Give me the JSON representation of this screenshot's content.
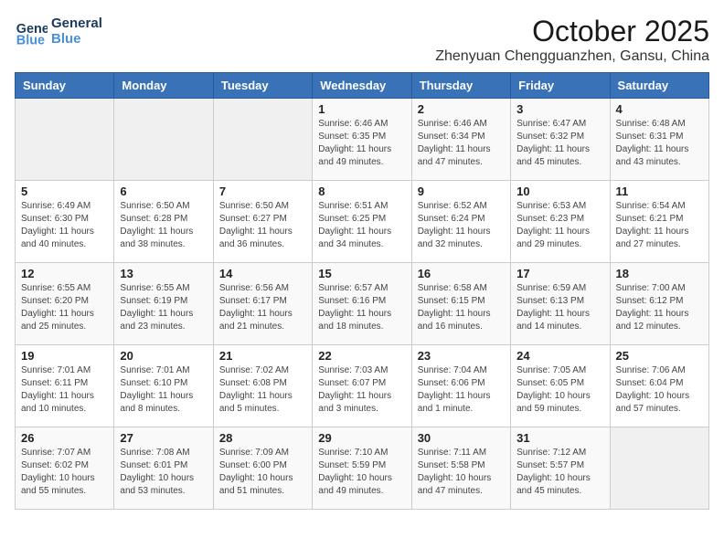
{
  "header": {
    "logo_line1": "General",
    "logo_line2": "Blue",
    "month": "October 2025",
    "location": "Zhenyuan Chengguanzhen, Gansu, China"
  },
  "weekdays": [
    "Sunday",
    "Monday",
    "Tuesday",
    "Wednesday",
    "Thursday",
    "Friday",
    "Saturday"
  ],
  "weeks": [
    [
      {
        "day": "",
        "info": ""
      },
      {
        "day": "",
        "info": ""
      },
      {
        "day": "",
        "info": ""
      },
      {
        "day": "1",
        "info": "Sunrise: 6:46 AM\nSunset: 6:35 PM\nDaylight: 11 hours\nand 49 minutes."
      },
      {
        "day": "2",
        "info": "Sunrise: 6:46 AM\nSunset: 6:34 PM\nDaylight: 11 hours\nand 47 minutes."
      },
      {
        "day": "3",
        "info": "Sunrise: 6:47 AM\nSunset: 6:32 PM\nDaylight: 11 hours\nand 45 minutes."
      },
      {
        "day": "4",
        "info": "Sunrise: 6:48 AM\nSunset: 6:31 PM\nDaylight: 11 hours\nand 43 minutes."
      }
    ],
    [
      {
        "day": "5",
        "info": "Sunrise: 6:49 AM\nSunset: 6:30 PM\nDaylight: 11 hours\nand 40 minutes."
      },
      {
        "day": "6",
        "info": "Sunrise: 6:50 AM\nSunset: 6:28 PM\nDaylight: 11 hours\nand 38 minutes."
      },
      {
        "day": "7",
        "info": "Sunrise: 6:50 AM\nSunset: 6:27 PM\nDaylight: 11 hours\nand 36 minutes."
      },
      {
        "day": "8",
        "info": "Sunrise: 6:51 AM\nSunset: 6:25 PM\nDaylight: 11 hours\nand 34 minutes."
      },
      {
        "day": "9",
        "info": "Sunrise: 6:52 AM\nSunset: 6:24 PM\nDaylight: 11 hours\nand 32 minutes."
      },
      {
        "day": "10",
        "info": "Sunrise: 6:53 AM\nSunset: 6:23 PM\nDaylight: 11 hours\nand 29 minutes."
      },
      {
        "day": "11",
        "info": "Sunrise: 6:54 AM\nSunset: 6:21 PM\nDaylight: 11 hours\nand 27 minutes."
      }
    ],
    [
      {
        "day": "12",
        "info": "Sunrise: 6:55 AM\nSunset: 6:20 PM\nDaylight: 11 hours\nand 25 minutes."
      },
      {
        "day": "13",
        "info": "Sunrise: 6:55 AM\nSunset: 6:19 PM\nDaylight: 11 hours\nand 23 minutes."
      },
      {
        "day": "14",
        "info": "Sunrise: 6:56 AM\nSunset: 6:17 PM\nDaylight: 11 hours\nand 21 minutes."
      },
      {
        "day": "15",
        "info": "Sunrise: 6:57 AM\nSunset: 6:16 PM\nDaylight: 11 hours\nand 18 minutes."
      },
      {
        "day": "16",
        "info": "Sunrise: 6:58 AM\nSunset: 6:15 PM\nDaylight: 11 hours\nand 16 minutes."
      },
      {
        "day": "17",
        "info": "Sunrise: 6:59 AM\nSunset: 6:13 PM\nDaylight: 11 hours\nand 14 minutes."
      },
      {
        "day": "18",
        "info": "Sunrise: 7:00 AM\nSunset: 6:12 PM\nDaylight: 11 hours\nand 12 minutes."
      }
    ],
    [
      {
        "day": "19",
        "info": "Sunrise: 7:01 AM\nSunset: 6:11 PM\nDaylight: 11 hours\nand 10 minutes."
      },
      {
        "day": "20",
        "info": "Sunrise: 7:01 AM\nSunset: 6:10 PM\nDaylight: 11 hours\nand 8 minutes."
      },
      {
        "day": "21",
        "info": "Sunrise: 7:02 AM\nSunset: 6:08 PM\nDaylight: 11 hours\nand 5 minutes."
      },
      {
        "day": "22",
        "info": "Sunrise: 7:03 AM\nSunset: 6:07 PM\nDaylight: 11 hours\nand 3 minutes."
      },
      {
        "day": "23",
        "info": "Sunrise: 7:04 AM\nSunset: 6:06 PM\nDaylight: 11 hours\nand 1 minute."
      },
      {
        "day": "24",
        "info": "Sunrise: 7:05 AM\nSunset: 6:05 PM\nDaylight: 10 hours\nand 59 minutes."
      },
      {
        "day": "25",
        "info": "Sunrise: 7:06 AM\nSunset: 6:04 PM\nDaylight: 10 hours\nand 57 minutes."
      }
    ],
    [
      {
        "day": "26",
        "info": "Sunrise: 7:07 AM\nSunset: 6:02 PM\nDaylight: 10 hours\nand 55 minutes."
      },
      {
        "day": "27",
        "info": "Sunrise: 7:08 AM\nSunset: 6:01 PM\nDaylight: 10 hours\nand 53 minutes."
      },
      {
        "day": "28",
        "info": "Sunrise: 7:09 AM\nSunset: 6:00 PM\nDaylight: 10 hours\nand 51 minutes."
      },
      {
        "day": "29",
        "info": "Sunrise: 7:10 AM\nSunset: 5:59 PM\nDaylight: 10 hours\nand 49 minutes."
      },
      {
        "day": "30",
        "info": "Sunrise: 7:11 AM\nSunset: 5:58 PM\nDaylight: 10 hours\nand 47 minutes."
      },
      {
        "day": "31",
        "info": "Sunrise: 7:12 AM\nSunset: 5:57 PM\nDaylight: 10 hours\nand 45 minutes."
      },
      {
        "day": "",
        "info": ""
      }
    ]
  ]
}
